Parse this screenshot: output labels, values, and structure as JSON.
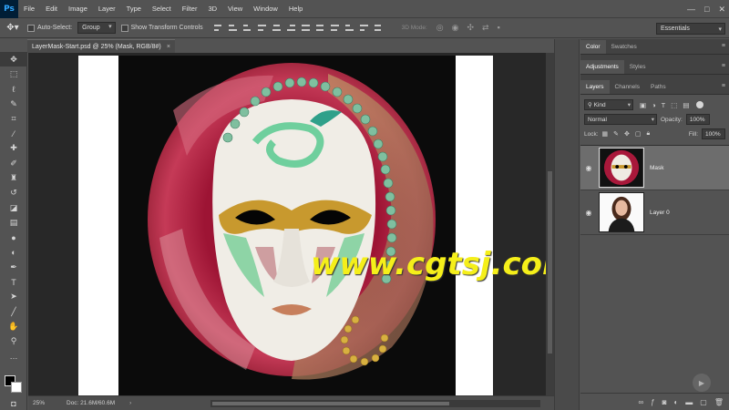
{
  "app": {
    "logo": "Ps"
  },
  "menu": [
    "File",
    "Edit",
    "Image",
    "Layer",
    "Type",
    "Select",
    "Filter",
    "3D",
    "View",
    "Window",
    "Help"
  ],
  "window_controls": {
    "minimize": "—",
    "maximize": "□",
    "close": "✕"
  },
  "options": {
    "tool_icon": "move-icon",
    "auto_select_label": "Auto-Select:",
    "auto_select_value": "Group",
    "transform_label": "Show Transform Controls",
    "mode_3d_label": "3D Mode:",
    "workspace": "Essentials"
  },
  "document": {
    "tab_title": "LayerMask-Start.psd @ 25% (Mask, RGB/8#)",
    "close": "×",
    "watermark": "www.cgtsj.com"
  },
  "status": {
    "zoom": "25%",
    "doc_info": "Doc: 21.6M/60.6M",
    "arrow": "›"
  },
  "panels": {
    "top_tabs": [
      "Color",
      "Swatches"
    ],
    "mid_tabs": [
      "Adjustments",
      "Styles"
    ],
    "layer_tabs": [
      "Layers",
      "Channels",
      "Paths"
    ],
    "menu_icon": "≡",
    "kind_label": "Kind",
    "blend_mode": "Normal",
    "opacity_label": "Opacity:",
    "opacity_value": "100%",
    "lock_label": "Lock:",
    "fill_label": "Fill:",
    "fill_value": "100%"
  },
  "layers": [
    {
      "name": "Mask",
      "selected": true
    },
    {
      "name": "Layer 0",
      "selected": false
    }
  ],
  "colors": {
    "ui_bg": "#535353",
    "panel_dark": "#424242",
    "canvas_bg": "#282828",
    "watermark": "#f5ef1a",
    "fabric_red": "#b01a3c",
    "mask_white": "#f0ede6",
    "bead_green": "#6fbf97",
    "gold": "#c8992e"
  }
}
